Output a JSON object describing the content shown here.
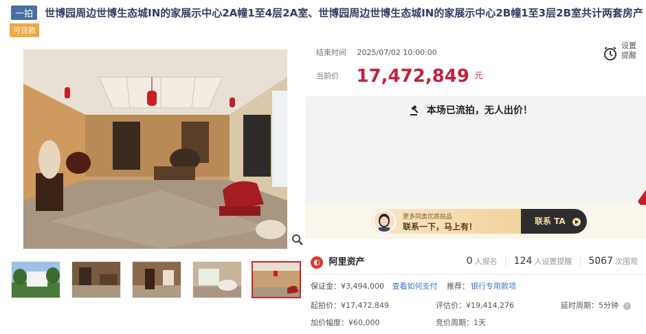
{
  "title": {
    "tag": "一拍",
    "text": "世博园周边世博生态城IN的家展示中心2A幢1至4层2A室、世博园周边世博生态城IN的家展示中心2B幢1至3层2B室共计两套房产",
    "loan_badge": "可贷款"
  },
  "auction": {
    "end_label": "结束时间",
    "end_time": "2025/07/02 10:00:00",
    "price_label": "当前价",
    "price": "17,472,849",
    "price_unit": "元",
    "reminder_label": "设置提醒",
    "status_message": "本场已流拍，无人出价！"
  },
  "banner": {
    "small_text": "更多同类优质拍品",
    "big_text": "联系一下，马上有！",
    "button_label": "联系 TA"
  },
  "platform": {
    "name": "阿里资产",
    "signups": "0",
    "signups_label": "人报名",
    "reminders": "124",
    "reminders_label": "人设置提醒",
    "views": "5067",
    "views_label": "次围观"
  },
  "details": {
    "deposit": "保证金：¥3,494,000",
    "deposit_link": "查看如何支付",
    "recommend_label": "推荐：",
    "recommend_link": "银行专用款项",
    "start_price": "起拍价：¥17,472,849",
    "appraisal": "评估价：¥19,414,276",
    "delay_period": "延时周期：5分钟",
    "increment": "加价幅度：¥60,000",
    "bid_period": "竞价周期：1天"
  },
  "icons": {
    "zoom": "magnifier-icon",
    "reminder": "alarm-clock-icon",
    "gavel": "gavel-icon",
    "help": "question-icon"
  },
  "colors": {
    "price": "#c1233c",
    "title": "#2e3e66",
    "link": "#3a76c9",
    "loan_badge": "#f2a742"
  }
}
